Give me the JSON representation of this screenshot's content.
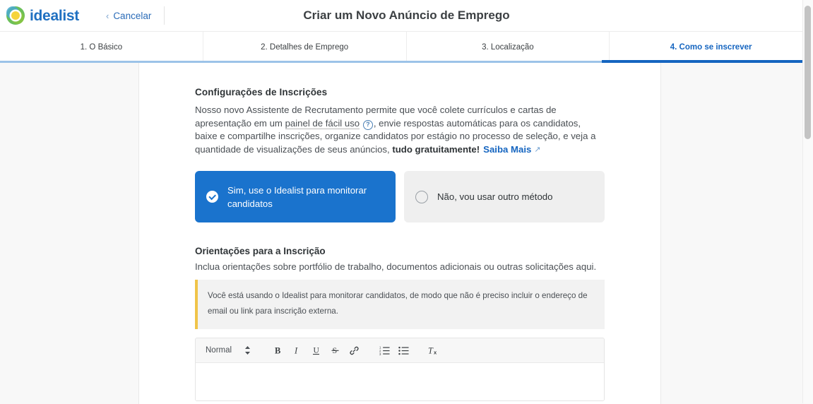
{
  "brand": {
    "name": "idealist",
    "logo_colors": [
      "#5bb85b",
      "#3ba9d6",
      "#f2d23a"
    ]
  },
  "header": {
    "cancel_label": "Cancelar",
    "cancel_chevron": "‹",
    "title": "Criar um Novo Anúncio de Emprego"
  },
  "tabs": [
    {
      "label": "1. O Básico",
      "active": false
    },
    {
      "label": "2. Detalhes de Emprego",
      "active": false
    },
    {
      "label": "3. Localização",
      "active": false
    },
    {
      "label": "4. Como se inscrever",
      "active": true
    }
  ],
  "accent_color": "#1565c0",
  "main": {
    "section_title": "Configurações de Inscrições",
    "lede": {
      "part1": "Nosso novo Assistente de Recrutamento permite que você colete currículos e cartas de apresentação em um ",
      "link_text": "painel de fácil uso",
      "help_icon": "question-mark-circle-icon",
      "help_glyph": "?",
      "part2": ", envie respostas automáticas para os candidatos, baixe e compartilhe inscrições, organize candidatos por estágio no processo de seleção, e veja a quantidade de visualizações de seus anúncios, ",
      "bold_text": "tudo gratuitamente!",
      "more_link": "Saiba Mais",
      "more_arrow": "↗"
    },
    "choices": [
      {
        "label": "Sim, use o Idealist para monitorar candidatos",
        "selected": true,
        "icon": "check-circle-icon"
      },
      {
        "label": "Não, vou usar outro método",
        "selected": false,
        "icon": "radio-empty-icon"
      }
    ],
    "guidance": {
      "title": "Orientações para a Inscrição",
      "subtitle": "Inclua orientações sobre portfólio de trabalho, documentos adicionais ou outras solicitações aqui.",
      "callout": "Você está usando o Idealist para monitorar candidatos, de modo que não é preciso incluir o endereço de email ou link para inscrição externa.",
      "callout_accent": "#f0c449"
    },
    "editor": {
      "format_label": "Normal",
      "format_arrows": "⇕",
      "buttons": [
        {
          "name": "bold-icon",
          "glyph": "B"
        },
        {
          "name": "italic-icon",
          "glyph": "I"
        },
        {
          "name": "underline-icon",
          "glyph": "U"
        },
        {
          "name": "strikethrough-icon",
          "glyph": "S"
        },
        {
          "name": "link-icon",
          "glyph": "🔗"
        },
        {
          "name": "ordered-list-icon",
          "glyph": "1."
        },
        {
          "name": "bullet-list-icon",
          "glyph": "•"
        },
        {
          "name": "clear-format-icon",
          "glyph": "Tx"
        }
      ],
      "content": ""
    }
  }
}
